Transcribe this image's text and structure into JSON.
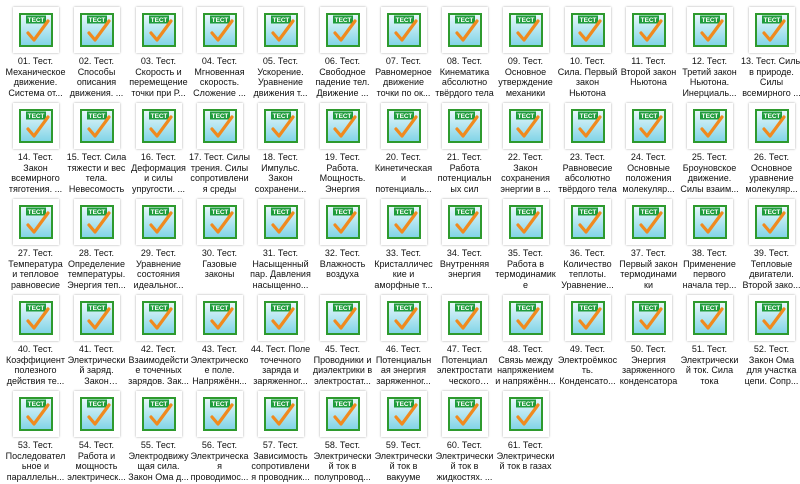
{
  "colors": {
    "icon_border": "#2e9a2e",
    "icon_fill_top": "#e9f8fb",
    "icon_fill_bottom": "#7fd3e6",
    "icon_header": "#1f9c3c",
    "icon_check": "#f08a1e",
    "icon_text": "#ffffff"
  },
  "icon_caption": "ТЕСТ",
  "files": [
    {
      "label": "01. Тест. Механическое движение. Система от...",
      "icon": "test-icon"
    },
    {
      "label": "02. Тест. Способы описания движения. ...",
      "icon": "test-icon"
    },
    {
      "label": "03. Тест. Скорость и перемещение точки при Р...",
      "icon": "test-icon"
    },
    {
      "label": "04. Тест. Мгновенная скорость. Сложение ...",
      "icon": "test-icon"
    },
    {
      "label": "05. Тест. Ускорение. Уравнение движения т...",
      "icon": "test-icon"
    },
    {
      "label": "06. Тест. Свободное падение тел. Движение ...",
      "icon": "test-icon"
    },
    {
      "label": "07. Тест. Равномерное движение точки по ок...",
      "icon": "test-icon"
    },
    {
      "label": "08. Тест. Кинематика абсолютно твёрдого тела",
      "icon": "test-icon"
    },
    {
      "label": "09. Тест. Основное утверждение механики",
      "icon": "test-icon"
    },
    {
      "label": "10. Тест. Сила. Первый закон Ньютона",
      "icon": "test-icon"
    },
    {
      "label": "11. Тест. Второй закон Ньютона",
      "icon": "test-icon"
    },
    {
      "label": "12. Тест. Третий закон Ньютона. Инерциаль...",
      "icon": "test-icon"
    },
    {
      "label": "13. Тест. Силы в природе. Силы всемирного ...",
      "icon": "test-icon"
    },
    {
      "label": "14. Тест. Закон всемирного тяготения. ...",
      "icon": "test-icon"
    },
    {
      "label": "15. Тест. Сила тяжести и вес тела. Невесомость",
      "icon": "test-icon"
    },
    {
      "label": "16. Тест. Деформация и силы упругости. ...",
      "icon": "test-icon"
    },
    {
      "label": "17. Тест. Силы трения. Силы сопротивления среды",
      "icon": "test-icon"
    },
    {
      "label": "18. Тест. Импульс. Закон сохранени...",
      "icon": "test-icon"
    },
    {
      "label": "19. Тест. Работа. Мощность. Энергия",
      "icon": "test-icon"
    },
    {
      "label": "20. Тест. Кинетическая и потенциаль...",
      "icon": "test-icon"
    },
    {
      "label": "21. Тест. Работа потенциальн ых сил",
      "icon": "test-icon"
    },
    {
      "label": "22. Тест. Закон сохранения энергии в ...",
      "icon": "test-icon"
    },
    {
      "label": "23. Тест. Равновесие абсолютно твёрдого тела",
      "icon": "test-icon"
    },
    {
      "label": "24. Тест. Основные положения молекуляр...",
      "icon": "test-icon"
    },
    {
      "label": "25. Тест. Броуновское движение. Силы взаим...",
      "icon": "test-icon"
    },
    {
      "label": "26. Тест. Основное уравнение молекуляр...",
      "icon": "test-icon"
    },
    {
      "label": "27. Тест. Температура и тепловое равновесие",
      "icon": "test-icon"
    },
    {
      "label": "28. Тест. Определение температуры. Энергия теп...",
      "icon": "test-icon"
    },
    {
      "label": "29. Тест. Уравнение состояния идеальног...",
      "icon": "test-icon"
    },
    {
      "label": "30. Тест. Газовые законы",
      "icon": "test-icon"
    },
    {
      "label": "31. Тест. Насыщенный пар. Давления насыщенно...",
      "icon": "test-icon"
    },
    {
      "label": "32. Тест. Влажность воздуха",
      "icon": "test-icon"
    },
    {
      "label": "33. Тест. Кристалличес кие и аморфные т...",
      "icon": "test-icon"
    },
    {
      "label": "34. Тест. Внутренняя энергия",
      "icon": "test-icon"
    },
    {
      "label": "35. Тест. Работа в термодинамик е",
      "icon": "test-icon"
    },
    {
      "label": "36. Тест. Количество теплоты. Уравнение...",
      "icon": "test-icon"
    },
    {
      "label": "37. Тест. Первый закон термодинами ки",
      "icon": "test-icon"
    },
    {
      "label": "38. Тест. Применение первого начала тер...",
      "icon": "test-icon"
    },
    {
      "label": "39. Тест. Тепловые двигатели. Второй зако...",
      "icon": "test-icon"
    },
    {
      "label": "40. Тест. Коэффициент полезного действия те...",
      "icon": "test-icon"
    },
    {
      "label": "41. Тест. Электрически й заряд. Закон сохранения ...",
      "icon": "test-icon"
    },
    {
      "label": "42. Тест. Взаимодейстие точечных зарядов. Зак...",
      "icon": "test-icon"
    },
    {
      "label": "43. Тест. Электрическо е поле. Напряжённ...",
      "icon": "test-icon"
    },
    {
      "label": "44. Тест. Поле точечного заряда и заряженног...",
      "icon": "test-icon"
    },
    {
      "label": "45. Тест. Проводники и диэлектрики в электростат...",
      "icon": "test-icon"
    },
    {
      "label": "46. Тест. Потенциальн ая энергия заряженног...",
      "icon": "test-icon"
    },
    {
      "label": "47. Тест. Потенциал электростати ческого поля...",
      "icon": "test-icon"
    },
    {
      "label": "48. Тест. Связь между напряжением и напряжённ...",
      "icon": "test-icon"
    },
    {
      "label": "49. Тест. Электроёмкос ть. Конденсато...",
      "icon": "test-icon"
    },
    {
      "label": "50. Тест. Энергия заряженного конденсатора",
      "icon": "test-icon"
    },
    {
      "label": "51. Тест. Электрически й ток. Сила тока",
      "icon": "test-icon"
    },
    {
      "label": "52. Тест. Закон Ома для участка цепи. Сопр...",
      "icon": "test-icon"
    },
    {
      "label": "53. Тест. Последовател ьное и параллельн...",
      "icon": "test-icon"
    },
    {
      "label": "54. Тест. Работа и мощность электрическ...",
      "icon": "test-icon"
    },
    {
      "label": "55. Тест. Электродвижу щая сила. Закон Ома д...",
      "icon": "test-icon"
    },
    {
      "label": "56. Тест. Электрическа я проводимос...",
      "icon": "test-icon"
    },
    {
      "label": "57. Тест. Зависимость сопротивления проводник...",
      "icon": "test-icon"
    },
    {
      "label": "58. Тест. Электрически й ток в полупровод...",
      "icon": "test-icon"
    },
    {
      "label": "59. Тест. Электрически й ток в вакууме",
      "icon": "test-icon"
    },
    {
      "label": "60. Тест. Электрически й ток в жидкостях. ...",
      "icon": "test-icon"
    },
    {
      "label": "61. Тест. Электрически й ток в газах",
      "icon": "test-icon"
    }
  ]
}
